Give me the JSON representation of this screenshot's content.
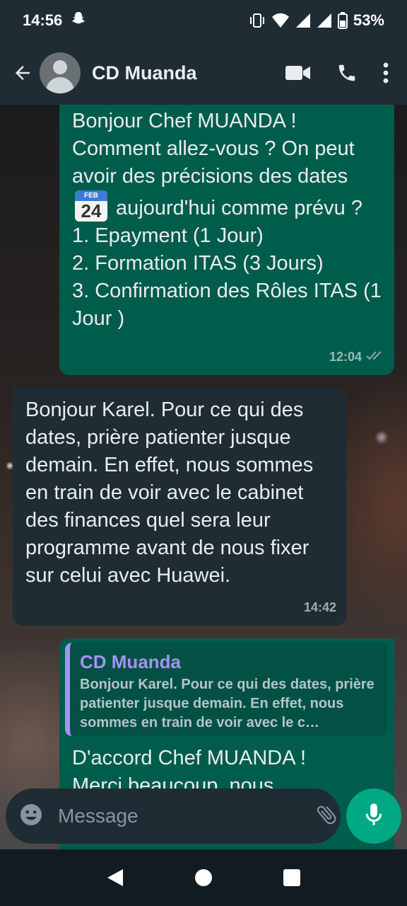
{
  "status_bar": {
    "time": "14:56",
    "battery": "53%"
  },
  "header": {
    "contact_name": "CD Muanda"
  },
  "messages": [
    {
      "direction": "outgoing",
      "text_before_emoji": "Bonjour Chef MUANDA !\nComment allez-vous ? On peut avoir des précisions des dates",
      "emoji": {
        "month": "FEB",
        "day": "24"
      },
      "text_after_emoji": " aujourd'hui comme prévu ?\n1. Epayment (1 Jour)\n2. Formation ITAS (3 Jours)\n3. Confirmation des Rôles ITAS (1 Jour )",
      "time": "12:04"
    },
    {
      "direction": "incoming",
      "text": "Bonjour Karel. Pour ce qui des dates, prière patienter jusque demain. En effet, nous sommes en train de voir avec le cabinet des finances quel sera leur programme avant de nous fixer sur celui avec Huawei.",
      "time": "14:42"
    },
    {
      "direction": "outgoing",
      "quote_author": "CD Muanda",
      "quote_text": "Bonjour Karel. Pour ce qui des dates, prière patienter jusque demain. En effet, nous sommes en train de voir avec le c…",
      "text": "D'accord Chef MUANDA !\nMerci beaucoup, nous"
    }
  ],
  "composer": {
    "placeholder": "Message"
  },
  "colors": {
    "outgoing_bubble": "#005c4b",
    "incoming_bubble": "#202c33",
    "accent": "#00a884",
    "quote_author": "#a791f5"
  }
}
